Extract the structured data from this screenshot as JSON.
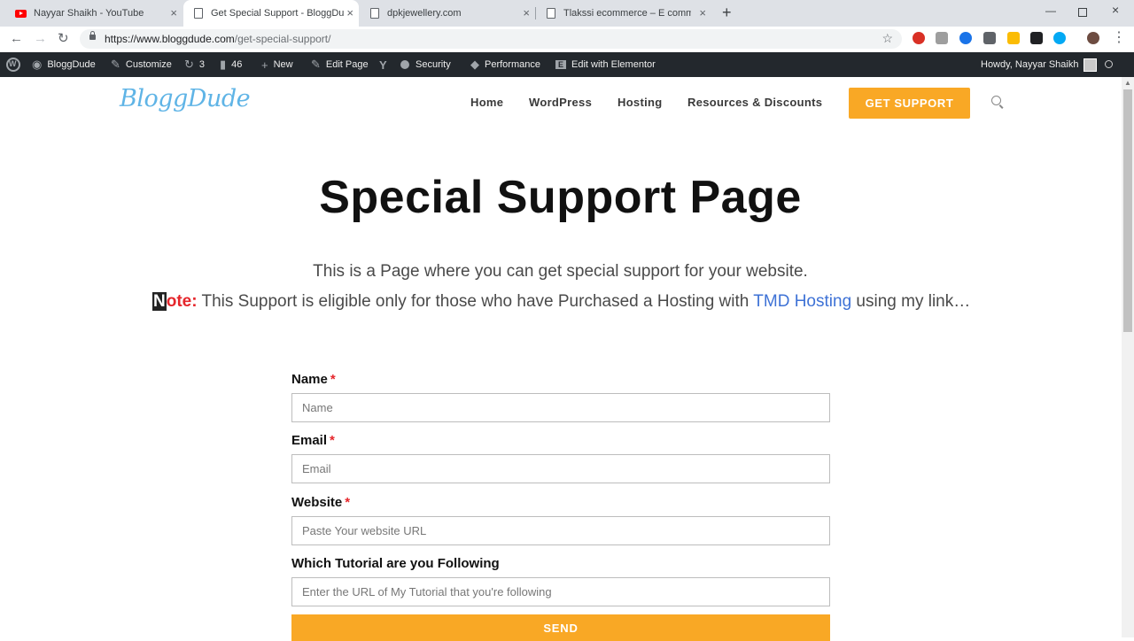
{
  "browser": {
    "tabs": [
      {
        "title": "Nayyar Shaikh - YouTube",
        "icon": "youtube-icon"
      },
      {
        "title": "Get Special Support - BloggDude",
        "icon": "page-icon",
        "active": true
      },
      {
        "title": "dpkjewellery.com",
        "icon": "page-icon"
      },
      {
        "title": "Tlakssi ecommerce – E commerce",
        "icon": "page-icon"
      }
    ],
    "close_glyph": "×",
    "new_tab_glyph": "+",
    "url_host": "https://www.bloggdude.com",
    "url_path": "/get-special-support/"
  },
  "adminbar": {
    "site": "BloggDude",
    "customize": "Customize",
    "updates_count": "3",
    "comments_count": "46",
    "new": "New",
    "edit_page": "Edit Page",
    "security": "Security",
    "performance": "Performance",
    "elementor": "Edit with Elementor",
    "howdy": "Howdy, Nayyar Shaikh"
  },
  "site": {
    "logo": "BloggDude",
    "nav": [
      "Home",
      "WordPress",
      "Hosting",
      "Resources & Discounts"
    ],
    "cta": "GET SUPPORT"
  },
  "content": {
    "title": "Special Support Page",
    "intro": "This is a Page where you can get special support for your website.",
    "note_label_first": "N",
    "note_label_rest": "ote:",
    "note_text": " This Support is eligible only for those who have Purchased a Hosting with ",
    "note_link": "TMD Hosting",
    "note_tail": " using my link…"
  },
  "form": {
    "required_mark": "*",
    "name_label": "Name",
    "name_placeholder": "Name",
    "email_label": "Email",
    "email_placeholder": "Email",
    "website_label": "Website",
    "website_placeholder": "Paste Your website URL",
    "tutorial_label": "Which Tutorial are you Following",
    "tutorial_placeholder": "Enter the URL of My Tutorial that you're following",
    "send": "SEND"
  },
  "colors": {
    "accent": "#f9a825",
    "logo": "#5fb4e6",
    "link": "#3e72d6",
    "required": "#e5262b",
    "adminbar": "#23282d"
  }
}
